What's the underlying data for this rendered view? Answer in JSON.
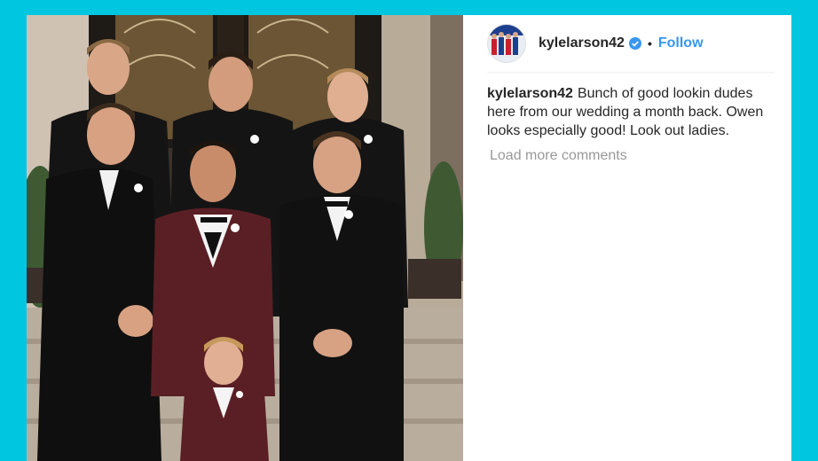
{
  "post": {
    "username": "kylelarson42",
    "separator": "•",
    "follow_label": "Follow",
    "caption": "Bunch of good lookin dudes here from our wedding a month back. Owen looks especially good! Look out ladies.",
    "load_more_label": "Load more comments"
  },
  "icons": {
    "verified": "verified-badge-icon",
    "avatar": "profile-avatar-image"
  },
  "colors": {
    "background": "#00c6e0",
    "follow": "#3897f0",
    "verified": "#3897f0",
    "muted": "#999999",
    "text": "#262626"
  }
}
